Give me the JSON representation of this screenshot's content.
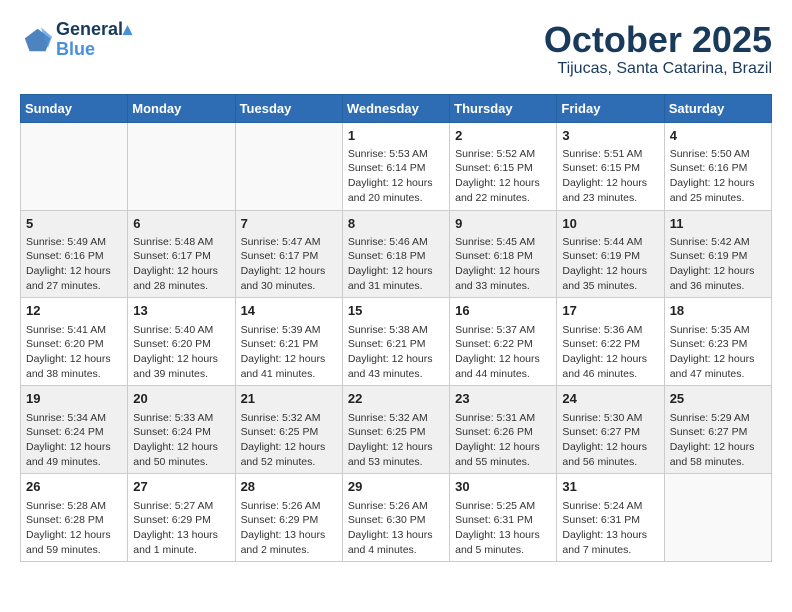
{
  "header": {
    "logo_line1": "General",
    "logo_line2": "Blue",
    "month": "October 2025",
    "location": "Tijucas, Santa Catarina, Brazil"
  },
  "weekdays": [
    "Sunday",
    "Monday",
    "Tuesday",
    "Wednesday",
    "Thursday",
    "Friday",
    "Saturday"
  ],
  "weeks": [
    [
      {
        "day": "",
        "info": ""
      },
      {
        "day": "",
        "info": ""
      },
      {
        "day": "",
        "info": ""
      },
      {
        "day": "1",
        "info": "Sunrise: 5:53 AM\nSunset: 6:14 PM\nDaylight: 12 hours\nand 20 minutes."
      },
      {
        "day": "2",
        "info": "Sunrise: 5:52 AM\nSunset: 6:15 PM\nDaylight: 12 hours\nand 22 minutes."
      },
      {
        "day": "3",
        "info": "Sunrise: 5:51 AM\nSunset: 6:15 PM\nDaylight: 12 hours\nand 23 minutes."
      },
      {
        "day": "4",
        "info": "Sunrise: 5:50 AM\nSunset: 6:16 PM\nDaylight: 12 hours\nand 25 minutes."
      }
    ],
    [
      {
        "day": "5",
        "info": "Sunrise: 5:49 AM\nSunset: 6:16 PM\nDaylight: 12 hours\nand 27 minutes."
      },
      {
        "day": "6",
        "info": "Sunrise: 5:48 AM\nSunset: 6:17 PM\nDaylight: 12 hours\nand 28 minutes."
      },
      {
        "day": "7",
        "info": "Sunrise: 5:47 AM\nSunset: 6:17 PM\nDaylight: 12 hours\nand 30 minutes."
      },
      {
        "day": "8",
        "info": "Sunrise: 5:46 AM\nSunset: 6:18 PM\nDaylight: 12 hours\nand 31 minutes."
      },
      {
        "day": "9",
        "info": "Sunrise: 5:45 AM\nSunset: 6:18 PM\nDaylight: 12 hours\nand 33 minutes."
      },
      {
        "day": "10",
        "info": "Sunrise: 5:44 AM\nSunset: 6:19 PM\nDaylight: 12 hours\nand 35 minutes."
      },
      {
        "day": "11",
        "info": "Sunrise: 5:42 AM\nSunset: 6:19 PM\nDaylight: 12 hours\nand 36 minutes."
      }
    ],
    [
      {
        "day": "12",
        "info": "Sunrise: 5:41 AM\nSunset: 6:20 PM\nDaylight: 12 hours\nand 38 minutes."
      },
      {
        "day": "13",
        "info": "Sunrise: 5:40 AM\nSunset: 6:20 PM\nDaylight: 12 hours\nand 39 minutes."
      },
      {
        "day": "14",
        "info": "Sunrise: 5:39 AM\nSunset: 6:21 PM\nDaylight: 12 hours\nand 41 minutes."
      },
      {
        "day": "15",
        "info": "Sunrise: 5:38 AM\nSunset: 6:21 PM\nDaylight: 12 hours\nand 43 minutes."
      },
      {
        "day": "16",
        "info": "Sunrise: 5:37 AM\nSunset: 6:22 PM\nDaylight: 12 hours\nand 44 minutes."
      },
      {
        "day": "17",
        "info": "Sunrise: 5:36 AM\nSunset: 6:22 PM\nDaylight: 12 hours\nand 46 minutes."
      },
      {
        "day": "18",
        "info": "Sunrise: 5:35 AM\nSunset: 6:23 PM\nDaylight: 12 hours\nand 47 minutes."
      }
    ],
    [
      {
        "day": "19",
        "info": "Sunrise: 5:34 AM\nSunset: 6:24 PM\nDaylight: 12 hours\nand 49 minutes."
      },
      {
        "day": "20",
        "info": "Sunrise: 5:33 AM\nSunset: 6:24 PM\nDaylight: 12 hours\nand 50 minutes."
      },
      {
        "day": "21",
        "info": "Sunrise: 5:32 AM\nSunset: 6:25 PM\nDaylight: 12 hours\nand 52 minutes."
      },
      {
        "day": "22",
        "info": "Sunrise: 5:32 AM\nSunset: 6:25 PM\nDaylight: 12 hours\nand 53 minutes."
      },
      {
        "day": "23",
        "info": "Sunrise: 5:31 AM\nSunset: 6:26 PM\nDaylight: 12 hours\nand 55 minutes."
      },
      {
        "day": "24",
        "info": "Sunrise: 5:30 AM\nSunset: 6:27 PM\nDaylight: 12 hours\nand 56 minutes."
      },
      {
        "day": "25",
        "info": "Sunrise: 5:29 AM\nSunset: 6:27 PM\nDaylight: 12 hours\nand 58 minutes."
      }
    ],
    [
      {
        "day": "26",
        "info": "Sunrise: 5:28 AM\nSunset: 6:28 PM\nDaylight: 12 hours\nand 59 minutes."
      },
      {
        "day": "27",
        "info": "Sunrise: 5:27 AM\nSunset: 6:29 PM\nDaylight: 13 hours\nand 1 minute."
      },
      {
        "day": "28",
        "info": "Sunrise: 5:26 AM\nSunset: 6:29 PM\nDaylight: 13 hours\nand 2 minutes."
      },
      {
        "day": "29",
        "info": "Sunrise: 5:26 AM\nSunset: 6:30 PM\nDaylight: 13 hours\nand 4 minutes."
      },
      {
        "day": "30",
        "info": "Sunrise: 5:25 AM\nSunset: 6:31 PM\nDaylight: 13 hours\nand 5 minutes."
      },
      {
        "day": "31",
        "info": "Sunrise: 5:24 AM\nSunset: 6:31 PM\nDaylight: 13 hours\nand 7 minutes."
      },
      {
        "day": "",
        "info": ""
      }
    ]
  ]
}
